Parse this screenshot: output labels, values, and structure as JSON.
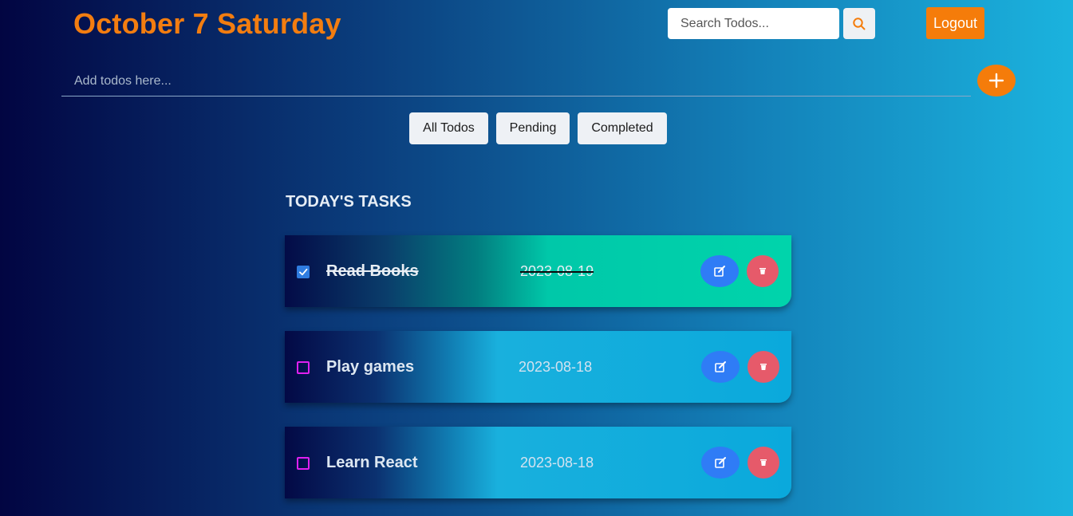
{
  "header": {
    "date_title": "October 7 Saturday",
    "search_placeholder": "Search Todos...",
    "logout_label": "Logout"
  },
  "add_todo": {
    "placeholder": "Add todos here...",
    "add_icon": "plus-icon"
  },
  "filters": [
    {
      "label": "All Todos"
    },
    {
      "label": "Pending"
    },
    {
      "label": "Completed"
    }
  ],
  "section_heading": "TODAY'S TASKS",
  "todos": [
    {
      "title": "Read Books",
      "date": "2023-08-19",
      "completed": true
    },
    {
      "title": "Play games",
      "date": "2023-08-18",
      "completed": false
    },
    {
      "title": "Learn React",
      "date": "2023-08-18",
      "completed": false
    }
  ],
  "colors": {
    "accent": "#f57c0a",
    "edit": "#2f7cf6",
    "delete": "#e65a6a",
    "checkbox_unchecked": "#e020f0",
    "checkbox_checked": "#2f7ce0"
  },
  "icons": {
    "search": "search-icon",
    "edit": "edit-icon",
    "delete": "trash-icon",
    "check": "check-icon"
  }
}
